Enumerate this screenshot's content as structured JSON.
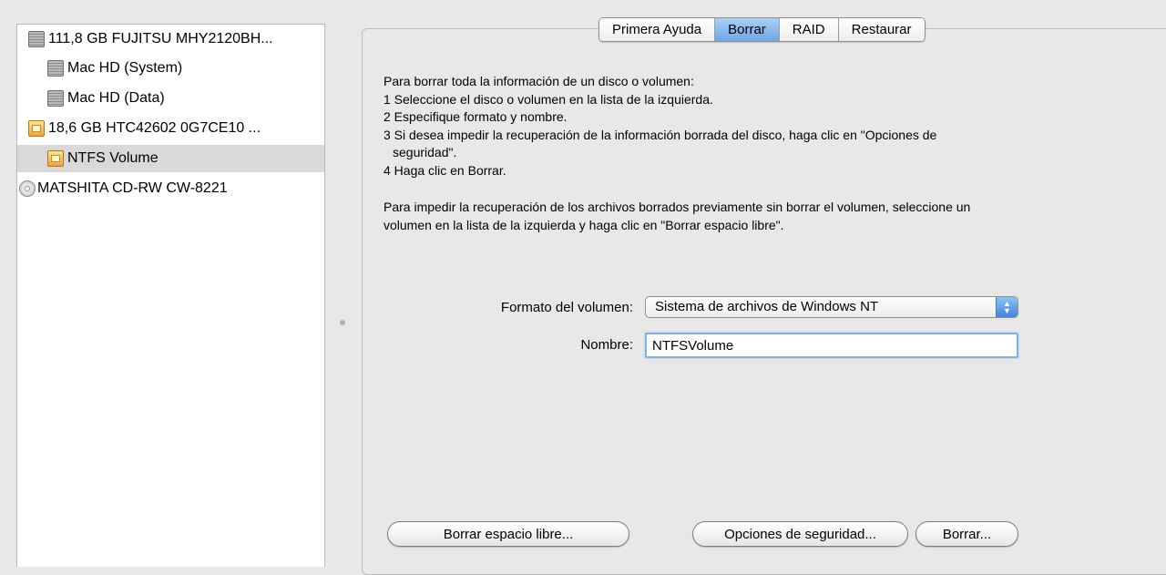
{
  "sidebar": {
    "items": [
      {
        "label": "111,8 GB FUJITSU MHY2120BH...",
        "icon": "hard-disk-icon"
      },
      {
        "label": "Mac HD (System)",
        "icon": "hard-disk-icon"
      },
      {
        "label": "Mac HD (Data)",
        "icon": "hard-disk-icon"
      },
      {
        "label": "18,6 GB HTC42602 0G7CE10 ...",
        "icon": "external-disk-icon"
      },
      {
        "label": "NTFS Volume",
        "icon": "external-disk-icon",
        "selected": true
      },
      {
        "label": "MATSHITA CD-RW CW-8221",
        "icon": "optical-drive-icon"
      }
    ]
  },
  "tabs": [
    {
      "label": "Primera Ayuda"
    },
    {
      "label": "Borrar",
      "active": true
    },
    {
      "label": "RAID"
    },
    {
      "label": "Restaurar"
    }
  ],
  "instructions": {
    "intro": "Para borrar toda la información de un disco o volumen:",
    "step1": "1 Seleccione el disco o volumen en la lista de la izquierda.",
    "step2": "2 Especifique formato y nombre.",
    "step3a": "3 Si desea impedir la recuperación de la información borrada del disco, haga clic en \"Opciones de",
    "step3b": "seguridad\".",
    "step4": "4 Haga clic en Borrar.",
    "free_a": "Para impedir la recuperación de los archivos borrados previamente sin borrar el volumen, seleccione un",
    "free_b": "volumen en la lista de la izquierda y haga clic en \"Borrar espacio libre\"."
  },
  "form": {
    "format_label": "Formato del volumen:",
    "format_value": "Sistema de archivos de Windows NT",
    "name_label": "Nombre:",
    "name_value": "NTFSVolume"
  },
  "buttons": {
    "erase_free_space": "Borrar espacio libre...",
    "security_options": "Opciones de seguridad...",
    "erase": "Borrar..."
  },
  "colors": {
    "active_tab": "#6fa8e8",
    "selection": "#d9d9d9",
    "focus_ring": "#7fb2ec"
  }
}
